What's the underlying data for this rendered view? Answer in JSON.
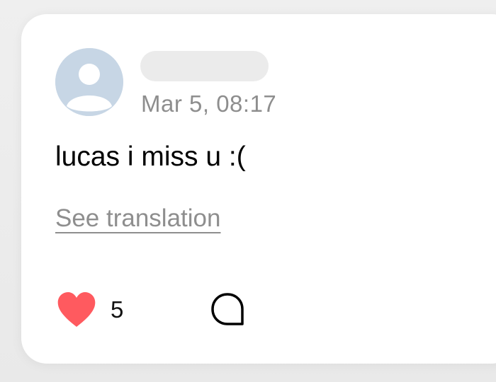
{
  "post": {
    "author_name": "",
    "timestamp": "Mar 5, 08:17",
    "text": "lucas i miss u :(",
    "translate_label": "See translation",
    "like_count": "5",
    "liked": true
  },
  "icons": {
    "avatar": "default-user-icon",
    "like": "heart-icon",
    "comment": "comment-bubble-icon"
  },
  "colors": {
    "heart": "#ff5a5f",
    "avatar_bg": "#c7d6e5",
    "muted_text": "#8e8e8e",
    "placeholder": "#ebebeb"
  }
}
